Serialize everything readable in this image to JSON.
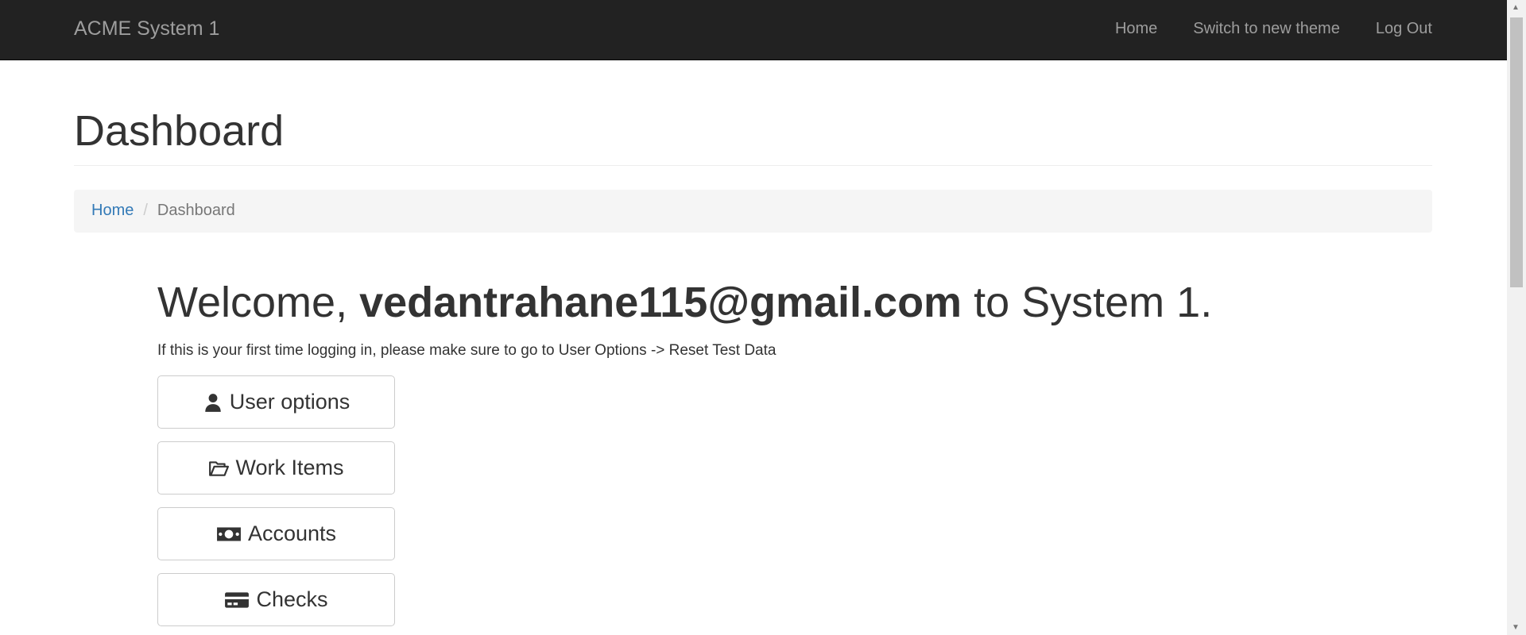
{
  "navbar": {
    "brand": "ACME System 1",
    "items": [
      "Home",
      "Switch to new theme",
      "Log Out"
    ]
  },
  "page": {
    "title": "Dashboard"
  },
  "breadcrumb": {
    "home": "Home",
    "separator": "/",
    "current": "Dashboard"
  },
  "welcome": {
    "prefix": "Welcome,",
    "user": "vedantrahane115@gmail.com",
    "suffix": "to System 1."
  },
  "hint": "If this is your first time logging in, please make sure to go to User Options -> Reset Test Data",
  "buttons": [
    {
      "label": "User options",
      "icon": "user-icon"
    },
    {
      "label": "Work Items",
      "icon": "folder-open-icon"
    },
    {
      "label": "Accounts",
      "icon": "money-icon"
    },
    {
      "label": "Checks",
      "icon": "credit-card-icon"
    }
  ]
}
